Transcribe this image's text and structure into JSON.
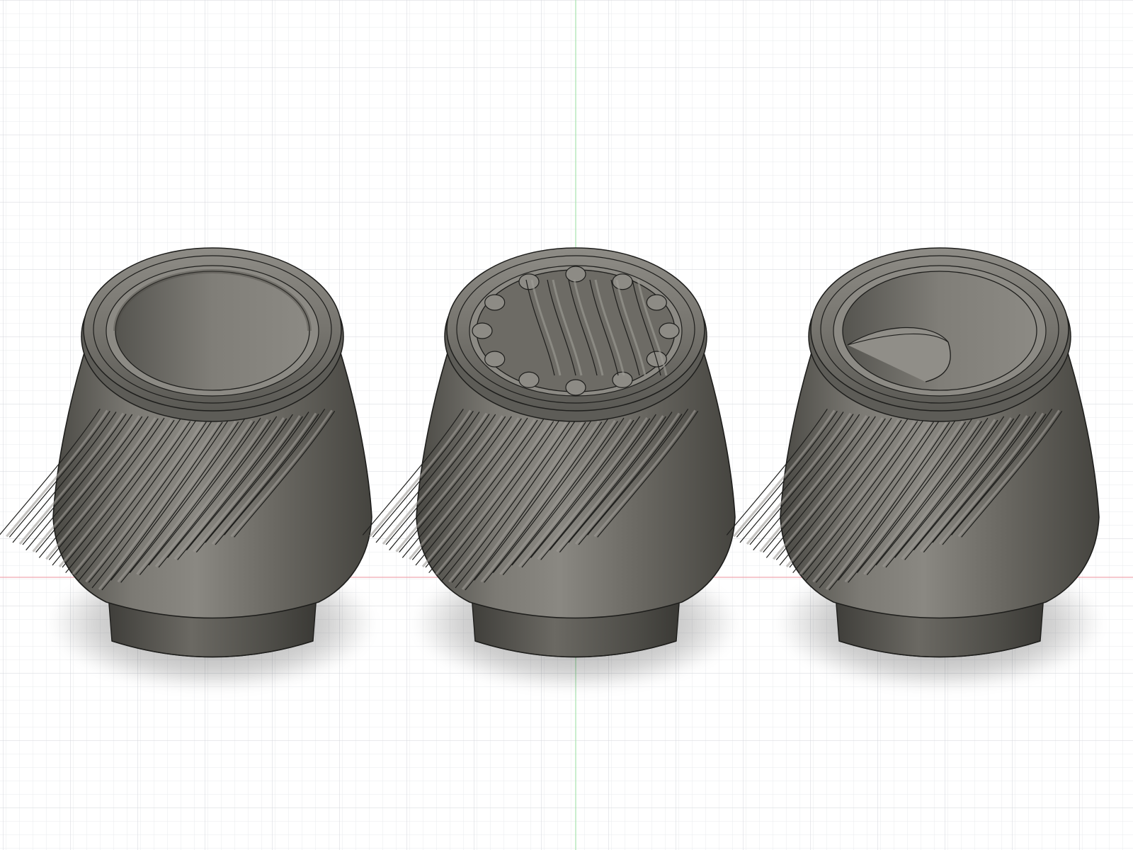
{
  "viewport": {
    "background_color": "#ffffff",
    "minor_grid_color": "#e9ebee",
    "major_grid_color": "#d3d6db",
    "x_axis_color": "#f0a7b0",
    "y_axis_color": "#a7e2ae",
    "model_body_color": "#6e6c66",
    "model_edge_color": "#1e1e1c",
    "shadow_color": "#000000"
  },
  "models": [
    {
      "name": "spiral-fluted-cup-plain-interior",
      "interior": "plain"
    },
    {
      "name": "spiral-fluted-cup-scalloped-interior",
      "interior": "scalloped"
    },
    {
      "name": "spiral-fluted-cup-vane-interior",
      "interior": "vane"
    }
  ]
}
